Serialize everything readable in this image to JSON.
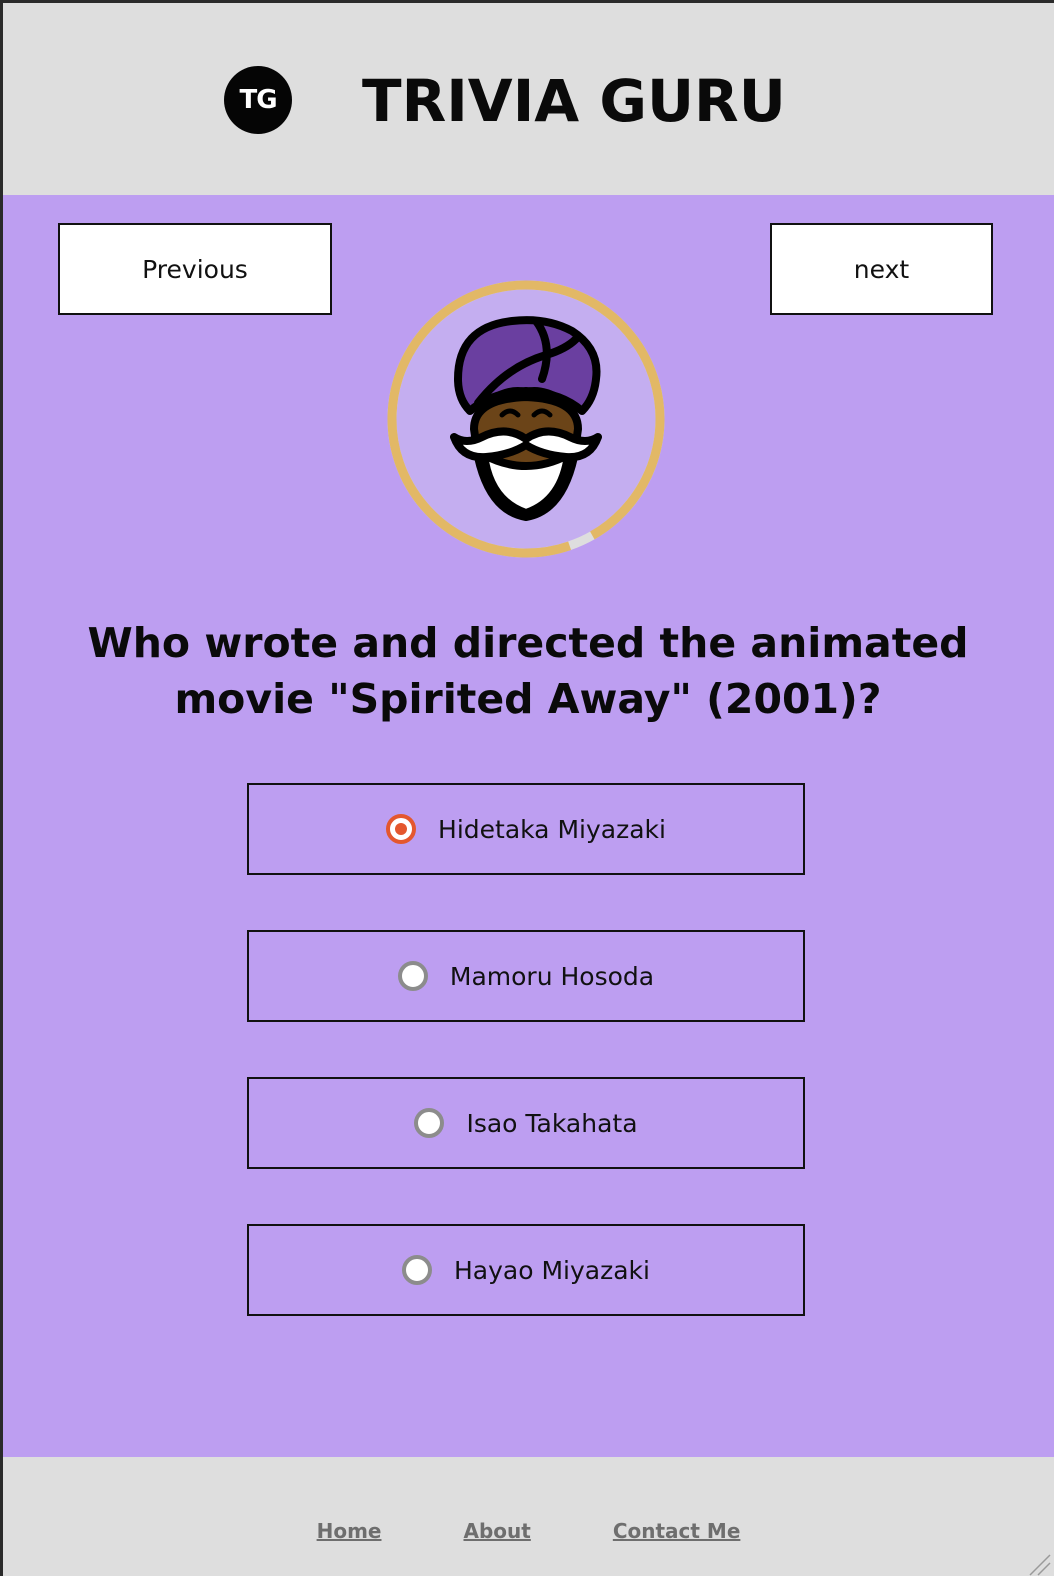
{
  "header": {
    "logo_text": "TG",
    "title": "TRIVIA GURU"
  },
  "nav": {
    "previous_label": "Previous",
    "next_label": "next"
  },
  "avatar": {
    "icon": "guru-avatar-icon",
    "timer_ring_color": "#e2b866",
    "timer_remaining_fraction": 0.97
  },
  "question": {
    "text": "Who wrote and directed the animated movie \"Spirited Away\" (2001)?"
  },
  "options": [
    {
      "label": "Hidetaka Miyazaki",
      "selected": true
    },
    {
      "label": "Mamoru Hosoda",
      "selected": false
    },
    {
      "label": "Isao Takahata",
      "selected": false
    },
    {
      "label": "Hayao Miyazaki",
      "selected": false
    }
  ],
  "footer": {
    "links": [
      "Home",
      "About",
      "Contact Me"
    ]
  },
  "colors": {
    "main_background": "#bd9ef1",
    "header_background": "#dedede",
    "radio_selected": "#e4572e"
  }
}
